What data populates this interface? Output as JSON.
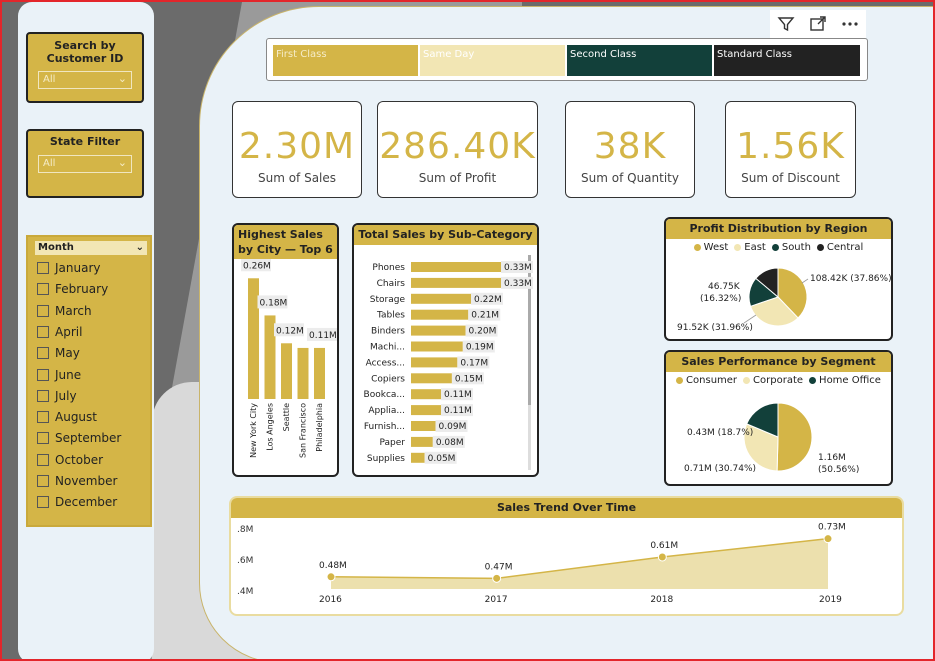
{
  "toolbar": {
    "filter_icon": "filter-icon",
    "focus_icon": "focus-mode-icon",
    "more_icon": "more-options-icon"
  },
  "slicers": {
    "customer": {
      "title": "Search by Customer ID",
      "value": "All"
    },
    "state": {
      "title": "State Filter",
      "value": "All"
    },
    "month": {
      "title": "Month",
      "items": [
        "January",
        "February",
        "March",
        "April",
        "May",
        "June",
        "July",
        "August",
        "September",
        "October",
        "November",
        "December"
      ]
    }
  },
  "ship_mode": {
    "tiles": [
      {
        "label": "First Class",
        "bg": "#d4b547",
        "fg": "#f5ecc8"
      },
      {
        "label": "Same Day",
        "bg": "#f2e6b4",
        "fg": "#ffffff"
      },
      {
        "label": "Second Class",
        "bg": "#12403a",
        "fg": "#ffffff"
      },
      {
        "label": "Standard Class",
        "bg": "#222222",
        "fg": "#ffffff"
      }
    ]
  },
  "kpis": [
    {
      "value": "2.30M",
      "label": "Sum of Sales"
    },
    {
      "value": "286.40K",
      "label": "Sum of Profit"
    },
    {
      "value": "38K",
      "label": "Sum of Quantity"
    },
    {
      "value": "1.56K",
      "label": "Sum of Discount"
    }
  ],
  "colors": {
    "gold": "#d4b547",
    "light_gold": "#f2e6b4",
    "dark_green": "#12403a",
    "dark": "#222222"
  },
  "chart_data": [
    {
      "id": "city",
      "type": "bar",
      "title": "Highest Sales by City — Top 6",
      "categories": [
        "New York City",
        "Los Angeles",
        "Seattle",
        "San Francisco",
        "Philadelphia"
      ],
      "values": [
        0.26,
        0.18,
        0.12,
        0.11,
        0.11
      ],
      "value_labels": [
        "0.26M",
        "0.18M",
        "0.12M",
        "",
        "0.11M"
      ]
    },
    {
      "id": "subcat",
      "type": "bar",
      "orientation": "horizontal",
      "title": "Total Sales by Sub-Category",
      "categories": [
        "Phones",
        "Chairs",
        "Storage",
        "Tables",
        "Binders",
        "Machi...",
        "Access...",
        "Copiers",
        "Bookca...",
        "Applia...",
        "Furnish...",
        "Paper",
        "Supplies"
      ],
      "values": [
        0.33,
        0.33,
        0.22,
        0.21,
        0.2,
        0.19,
        0.17,
        0.15,
        0.11,
        0.11,
        0.09,
        0.08,
        0.05
      ],
      "value_labels": [
        "0.33M",
        "0.33M",
        "0.22M",
        "0.21M",
        "0.20M",
        "0.19M",
        "0.17M",
        "0.15M",
        "0.11M",
        "0.11M",
        "0.09M",
        "0.08M",
        "0.05M"
      ]
    },
    {
      "id": "region",
      "type": "pie",
      "title": "Profit Distribution by Region",
      "categories": [
        "West",
        "East",
        "South",
        "Central"
      ],
      "values": [
        108.42,
        91.52,
        46.75,
        39.71
      ],
      "colors": [
        "#d4b547",
        "#f2e6b4",
        "#12403a",
        "#222222"
      ],
      "data_labels": [
        "108.42K (37.86%)",
        "91.52K (31.96%)",
        "46.75K (16.32%)",
        ""
      ]
    },
    {
      "id": "segment",
      "type": "pie",
      "title": "Sales Performance by Segment",
      "categories": [
        "Consumer",
        "Corporate",
        "Home Office"
      ],
      "values": [
        1.16,
        0.71,
        0.43
      ],
      "colors": [
        "#d4b547",
        "#f2e6b4",
        "#12403a"
      ],
      "data_labels": [
        "1.16M (50.56%)",
        "0.71M (30.74%)",
        "0.43M (18.7%)"
      ]
    },
    {
      "id": "trend",
      "type": "area",
      "title": "Sales Trend Over Time",
      "x": [
        "2016",
        "2017",
        "2018",
        "2019"
      ],
      "values": [
        0.48,
        0.47,
        0.61,
        0.73
      ],
      "value_labels": [
        "0.48M",
        "0.47M",
        "0.61M",
        "0.73M"
      ],
      "y_ticks": [
        ".8M",
        ".6M",
        ".4M"
      ],
      "ylim": [
        0.4,
        0.8
      ]
    }
  ]
}
